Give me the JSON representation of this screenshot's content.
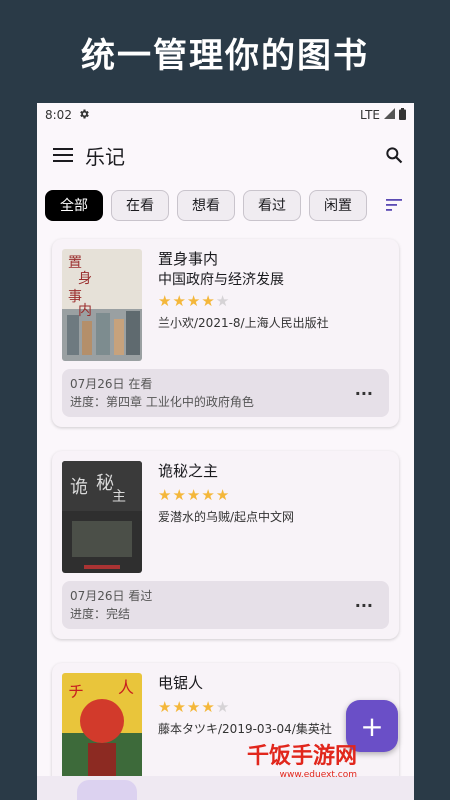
{
  "promo": {
    "text": "统一管理你的图书"
  },
  "status": {
    "time": "8:02",
    "network": "LTE"
  },
  "appbar": {
    "title": "乐记"
  },
  "filters": [
    "全部",
    "在看",
    "想看",
    "看过",
    "闲置"
  ],
  "books": [
    {
      "title": "置身事内",
      "subtitle": "中国政府与经济发展",
      "rating": 4,
      "meta": "兰小欢/2021-8/上海人民出版社",
      "note_line1": "07月26日 在看",
      "note_line2": "进度：第四章 工业化中的政府角色",
      "cover_color": "#d8d2c6"
    },
    {
      "title": "诡秘之主",
      "subtitle": "",
      "rating": 5,
      "meta": "爱潜水的乌贼/起点中文网",
      "note_line1": "07月26日 看过",
      "note_line2": "进度：完结",
      "cover_color": "#2b2b2b"
    },
    {
      "title": "电锯人",
      "subtitle": "",
      "rating": 4,
      "meta": "藤本タツキ/2019-03-04/集英社",
      "note_line1": "",
      "note_line2": "",
      "cover_color": "#e7c43a"
    }
  ],
  "fab": {
    "label": "+"
  },
  "watermark": {
    "text": "千饭手游网",
    "sub": "www.eduext.com"
  }
}
